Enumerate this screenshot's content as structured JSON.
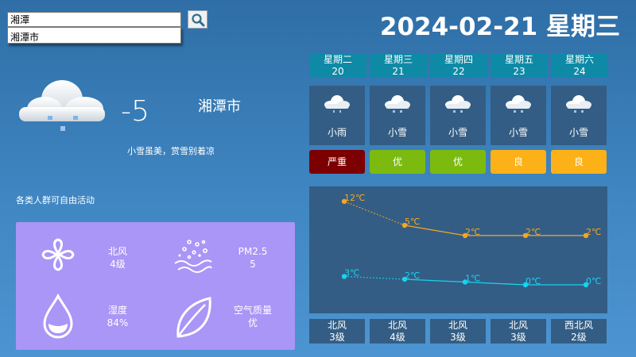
{
  "search": {
    "value": "湘潭",
    "suggestion": "湘潭市"
  },
  "date_title": "2024-02-21 星期三",
  "current": {
    "temp": "-5",
    "city": "湘潭市",
    "desc": "小雪虽美，赏雪别着凉",
    "icon": "cloud-snow-icon"
  },
  "advice": "各类人群可自由活动",
  "details": {
    "wind_dir": "北风",
    "wind_level": "4级",
    "pm_label": "PM2.5",
    "pm_value": "5",
    "humidity_label": "湿度",
    "humidity_value": "84%",
    "aq_label": "空气质量",
    "aq_value": "优"
  },
  "forecast": [
    {
      "weekday": "星期二",
      "day": "20",
      "weather": "小雨",
      "aqi": "严重",
      "aqi_color": "#7d0000",
      "high": "12℃",
      "low": "3℃",
      "wind_dir": "北风",
      "wind_level": "3级"
    },
    {
      "weekday": "星期三",
      "day": "21",
      "weather": "小雪",
      "aqi": "优",
      "aqi_color": "#7cba0f",
      "high": "5℃",
      "low": "2℃",
      "wind_dir": "北风",
      "wind_level": "4级"
    },
    {
      "weekday": "星期四",
      "day": "22",
      "weather": "小雪",
      "aqi": "优",
      "aqi_color": "#7cba0f",
      "high": "2℃",
      "low": "1℃",
      "wind_dir": "北风",
      "wind_level": "3级"
    },
    {
      "weekday": "星期五",
      "day": "23",
      "weather": "小雪",
      "aqi": "良",
      "aqi_color": "#fbb117",
      "high": "2℃",
      "low": "0℃",
      "wind_dir": "北风",
      "wind_level": "3级"
    },
    {
      "weekday": "星期六",
      "day": "24",
      "weather": "小雪",
      "aqi": "良",
      "aqi_color": "#fbb117",
      "high": "2℃",
      "low": "0℃",
      "wind_dir": "西北风",
      "wind_level": "2级"
    }
  ],
  "chart_data": {
    "type": "line",
    "x": [
      "20",
      "21",
      "22",
      "23",
      "24"
    ],
    "series": [
      {
        "values": [
          12,
          5,
          2,
          2,
          2
        ],
        "color": "#f5a623"
      },
      {
        "values": [
          3,
          2,
          1,
          0,
          0
        ],
        "color": "#19d3f0"
      }
    ]
  },
  "colors": {
    "panel": "#335d84",
    "tab": "#0f8aa6",
    "info_panel": "#a996f6"
  }
}
